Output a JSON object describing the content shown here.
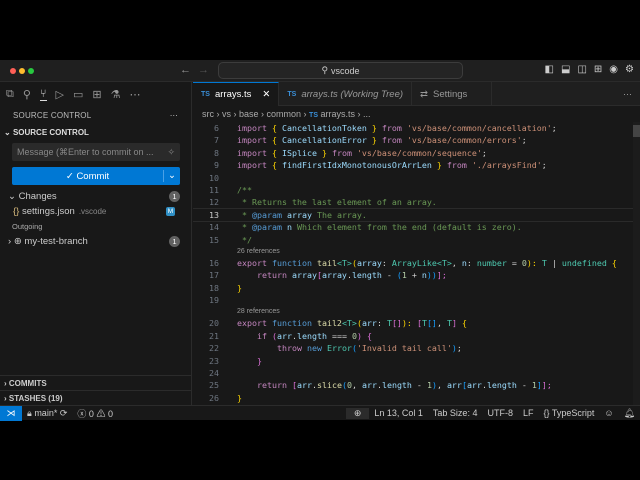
{
  "title": {
    "search": "vscode"
  },
  "sidebar": {
    "header": "SOURCE CONTROL",
    "section": "SOURCE CONTROL",
    "message_placeholder": "Message (⌘Enter to commit on ...",
    "commit_label": "Commit",
    "changes_label": "Changes",
    "changes_count": "1",
    "file_name": "settings.json",
    "file_dir": ".vscode",
    "file_status": "M",
    "outgoing_label": "Outgoing",
    "branch": "my-test-branch",
    "branch_count": "1",
    "commits": "COMMITS",
    "stashes": "STASHES (19)"
  },
  "tabs": [
    {
      "label": "arrays.ts",
      "icon": "TS"
    },
    {
      "label": "arrays.ts (Working Tree)",
      "icon": "TS"
    },
    {
      "label": "Settings",
      "icon": "settings"
    }
  ],
  "breadcrumb": [
    "src",
    "vs",
    "base",
    "common",
    "arrays.ts",
    "..."
  ],
  "editor": {
    "lines": [
      {
        "n": "6",
        "t": [
          [
            "import",
            "#c586c0"
          ],
          " ",
          [
            "{",
            "#ffd700"
          ],
          " ",
          [
            "CancellationToken",
            "#9cdcfe"
          ],
          " ",
          [
            "}",
            "#ffd700"
          ],
          " ",
          [
            "from",
            "#c586c0"
          ],
          " ",
          [
            "'vs/base/common/cancellation'",
            "#ce9178"
          ],
          ";"
        ]
      },
      {
        "n": "7",
        "t": [
          [
            "import",
            "#c586c0"
          ],
          " ",
          [
            "{",
            "#ffd700"
          ],
          " ",
          [
            "CancellationError",
            "#9cdcfe"
          ],
          " ",
          [
            "}",
            "#ffd700"
          ],
          " ",
          [
            "from",
            "#c586c0"
          ],
          " ",
          [
            "'vs/base/common/errors'",
            "#ce9178"
          ],
          ";"
        ]
      },
      {
        "n": "8",
        "t": [
          [
            "import",
            "#c586c0"
          ],
          " ",
          [
            "{",
            "#ffd700"
          ],
          " ",
          [
            "ISplice",
            "#9cdcfe"
          ],
          " ",
          [
            "}",
            "#ffd700"
          ],
          " ",
          [
            "from",
            "#c586c0"
          ],
          " ",
          [
            "'vs/base/common/sequence'",
            "#ce9178"
          ],
          ";"
        ]
      },
      {
        "n": "9",
        "t": [
          [
            "import",
            "#c586c0"
          ],
          " ",
          [
            "{",
            "#ffd700"
          ],
          " ",
          [
            "findFirstIdxMonotonousOrArrLen",
            "#9cdcfe"
          ],
          " ",
          [
            "}",
            "#ffd700"
          ],
          " ",
          [
            "from",
            "#c586c0"
          ],
          " ",
          [
            "'./arraysFind'",
            "#ce9178"
          ],
          ";"
        ]
      },
      {
        "n": "10",
        "t": []
      },
      {
        "n": "11",
        "t": [
          [
            "/**",
            "#6a9955"
          ]
        ]
      },
      {
        "n": "12",
        "t": [
          [
            " * Returns the last element of an array.",
            "#6a9955"
          ]
        ]
      },
      {
        "n": "13",
        "cur": true,
        "t": [
          [
            " * ",
            "#6a9955"
          ],
          [
            "@param",
            "#569cd6"
          ],
          " ",
          [
            "array",
            "#9cdcfe"
          ],
          [
            " The array.",
            "#6a9955"
          ]
        ]
      },
      {
        "n": "14",
        "t": [
          [
            " * ",
            "#6a9955"
          ],
          [
            "@param",
            "#569cd6"
          ],
          " ",
          [
            "n",
            "#9cdcfe"
          ],
          [
            " Which element from the end (default is zero).",
            "#6a9955"
          ]
        ]
      },
      {
        "n": "15",
        "t": [
          [
            " */",
            "#6a9955"
          ]
        ]
      },
      {
        "lens": "26 references"
      },
      {
        "n": "16",
        "t": [
          [
            "export",
            "#c586c0"
          ],
          " ",
          [
            "function",
            "#569cd6"
          ],
          " ",
          [
            "tail",
            "#dcdcaa"
          ],
          [
            "<T>",
            "#4ec9b0"
          ],
          [
            "(",
            "#ffd700"
          ],
          [
            "array",
            "#9cdcfe"
          ],
          ": ",
          [
            "ArrayLike",
            "#4ec9b0"
          ],
          [
            "<T>",
            "#4ec9b0"
          ],
          ", ",
          [
            "n",
            "#9cdcfe"
          ],
          ": ",
          [
            "number",
            "#4ec9b0"
          ],
          " = ",
          [
            "0",
            "#b5cea8"
          ],
          [
            "):",
            "#ffd700"
          ],
          " ",
          [
            "T",
            "#4ec9b0"
          ],
          " | ",
          [
            "undefined",
            "#4ec9b0"
          ],
          " ",
          [
            "{",
            "#ffd700"
          ]
        ]
      },
      {
        "n": "17",
        "t": [
          "    ",
          [
            "return",
            "#c586c0"
          ],
          " ",
          [
            "array",
            "#9cdcfe"
          ],
          [
            "[",
            "#da70d6"
          ],
          [
            "array",
            "#9cdcfe"
          ],
          ".",
          [
            "length",
            "#9cdcfe"
          ],
          " - ",
          [
            "(",
            "#179fff"
          ],
          [
            "1",
            "#b5cea8"
          ],
          " + ",
          [
            "n",
            "#9cdcfe"
          ],
          [
            "))",
            "#179fff"
          ],
          [
            "];",
            "#da70d6"
          ]
        ]
      },
      {
        "n": "18",
        "t": [
          [
            "}",
            "#ffd700"
          ]
        ]
      },
      {
        "n": "19",
        "t": []
      },
      {
        "lens": "28 references"
      },
      {
        "n": "20",
        "t": [
          [
            "export",
            "#c586c0"
          ],
          " ",
          [
            "function",
            "#569cd6"
          ],
          " ",
          [
            "tail2",
            "#dcdcaa"
          ],
          [
            "<T>",
            "#4ec9b0"
          ],
          [
            "(",
            "#ffd700"
          ],
          [
            "arr",
            "#9cdcfe"
          ],
          ": ",
          [
            "T",
            "#4ec9b0"
          ],
          [
            "[]",
            "#da70d6"
          ],
          [
            "):",
            "#ffd700"
          ],
          " ",
          [
            "[",
            "#da70d6"
          ],
          [
            "T",
            "#4ec9b0"
          ],
          [
            "[]",
            "#179fff"
          ],
          ", ",
          [
            "T",
            "#4ec9b0"
          ],
          [
            "]",
            "#da70d6"
          ],
          " ",
          [
            "{",
            "#ffd700"
          ]
        ]
      },
      {
        "n": "21",
        "t": [
          "    ",
          [
            "if",
            "#c586c0"
          ],
          " ",
          [
            "(",
            "#da70d6"
          ],
          [
            "arr",
            "#9cdcfe"
          ],
          ".",
          [
            "length",
            "#9cdcfe"
          ],
          " === ",
          [
            "0",
            "#b5cea8"
          ],
          [
            ")",
            "#da70d6"
          ],
          " ",
          [
            "{",
            "#da70d6"
          ]
        ]
      },
      {
        "n": "22",
        "t": [
          "        ",
          [
            "throw",
            "#c586c0"
          ],
          " ",
          [
            "new",
            "#569cd6"
          ],
          " ",
          [
            "Error",
            "#4ec9b0"
          ],
          [
            "(",
            "#179fff"
          ],
          [
            "'Invalid tail call'",
            "#ce9178"
          ],
          [
            ")",
            "#179fff"
          ],
          ";"
        ]
      },
      {
        "n": "23",
        "t": [
          "    ",
          [
            "}",
            "#da70d6"
          ]
        ]
      },
      {
        "n": "24",
        "t": []
      },
      {
        "n": "25",
        "t": [
          "    ",
          [
            "return",
            "#c586c0"
          ],
          " ",
          [
            "[",
            "#da70d6"
          ],
          [
            "arr",
            "#9cdcfe"
          ],
          ".",
          [
            "slice",
            "#dcdcaa"
          ],
          [
            "(",
            "#179fff"
          ],
          [
            "0",
            "#b5cea8"
          ],
          ", ",
          [
            "arr",
            "#9cdcfe"
          ],
          ".",
          [
            "length",
            "#9cdcfe"
          ],
          " - ",
          [
            "1",
            "#b5cea8"
          ],
          [
            ")",
            "#179fff"
          ],
          ", ",
          [
            "arr",
            "#9cdcfe"
          ],
          [
            "[",
            "#179fff"
          ],
          [
            "arr",
            "#9cdcfe"
          ],
          ".",
          [
            "length",
            "#9cdcfe"
          ],
          " - ",
          [
            "1",
            "#b5cea8"
          ],
          [
            "]",
            "#179fff"
          ],
          [
            "];",
            "#da70d6"
          ]
        ]
      },
      {
        "n": "26",
        "t": [
          [
            "}",
            "#ffd700"
          ]
        ]
      }
    ]
  },
  "status": {
    "branch": "main*",
    "errors": "0",
    "warnings": "0",
    "position": "Ln 13, Col 1",
    "tab_size": "Tab Size: 4",
    "encoding": "UTF-8",
    "eol": "LF",
    "language": "TypeScript"
  }
}
